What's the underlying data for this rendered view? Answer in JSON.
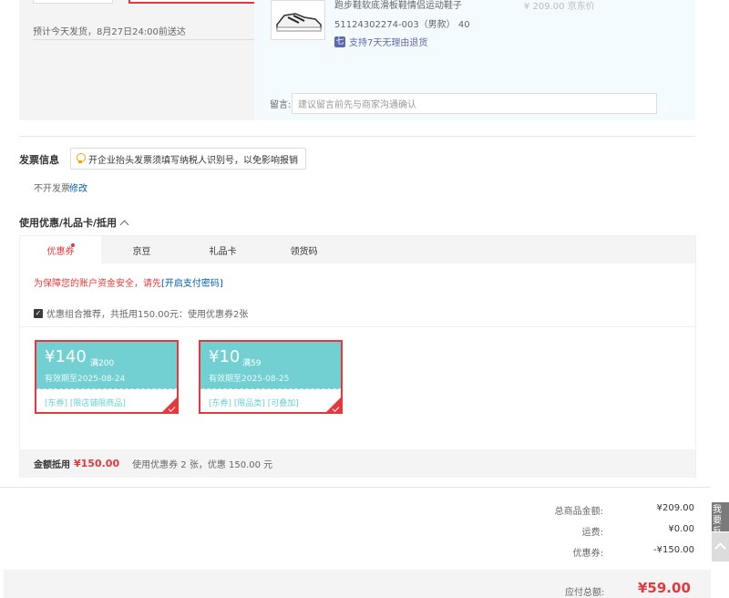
{
  "shipping": {
    "delivery_note": "预计今天发货，8月27日24:00前送达"
  },
  "goods": {
    "name": "跑步鞋软底滑板鞋情侣运动鞋子",
    "sku": "51124302274-003（男款） 40",
    "price": "¥ 209.00 京东价",
    "return_policy": "支持7天无理由退货",
    "return_icon": "七",
    "message_label": "留言:",
    "message_placeholder": "建议留言前先与商家沟通确认"
  },
  "invoice": {
    "title": "发票信息",
    "tip": "开企业抬头发票须填写纳税人识别号，以免影响报销",
    "value": "不开发票",
    "edit_label": "修改"
  },
  "coupons": {
    "title": "使用优惠/礼品卡/抵用",
    "tabs": [
      {
        "label": "优惠券",
        "active": true
      },
      {
        "label": "京豆",
        "active": false
      },
      {
        "label": "礼品卡",
        "active": false
      },
      {
        "label": "领货码",
        "active": false
      }
    ],
    "warning_text": "为保障您的账户资金安全，请先",
    "warning_link": "[开启支付密码]",
    "combo_text": "优惠组合推荐，共抵用150.00元：使用优惠券2张",
    "items": [
      {
        "amount": "¥140",
        "condition": "满200",
        "expiry": "有效期至2025-08-24",
        "tags": "[东券] [限店铺限商品]"
      },
      {
        "amount": "¥10",
        "condition": "满59",
        "expiry": "有效期至2025-08-25",
        "tags": "[东券] [限品类] [可叠加]"
      }
    ],
    "summary_label": "金额抵用",
    "summary_value": "¥150.00",
    "summary_info": "使用优惠券 2 张，优惠 150.00 元"
  },
  "totals": {
    "rows": [
      {
        "label": "总商品金额:",
        "value": "¥209.00"
      },
      {
        "label": "运费:",
        "value": "¥0.00"
      },
      {
        "label": "优惠券:",
        "value": "-¥150.00"
      }
    ],
    "pay_label": "应付总额:",
    "pay_value": "¥59.00"
  },
  "side": {
    "feedback_label": "我要反馈"
  },
  "colors": {
    "accent": "#e4393c",
    "link": "#005ea7",
    "coupon_teal": "#72d0d2"
  }
}
